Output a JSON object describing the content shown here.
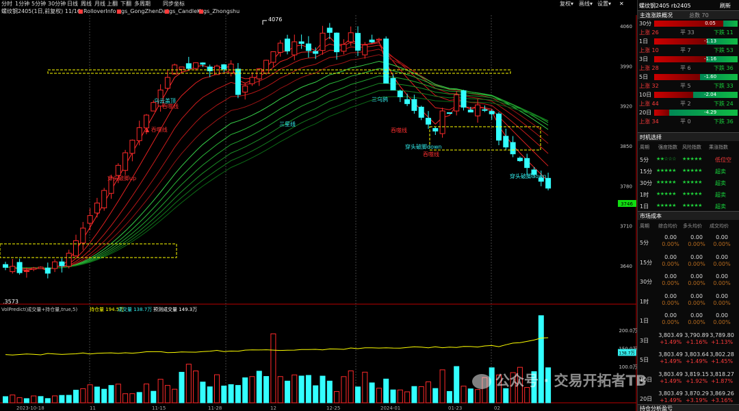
{
  "top": {
    "tabs": [
      "分时",
      "1分钟",
      "5分钟",
      "30分钟",
      "日线",
      "周线",
      "月线",
      "上翻",
      "下翻",
      "多周期",
      "同步坐标"
    ],
    "right": [
      "复权",
      "画线",
      "设置"
    ],
    "title": "螺纹钢2405 rb2405",
    "refresh": "刷新"
  },
  "legend": {
    "symbol": "螺纹钢2405(1日,前复权) 11/16",
    "items": [
      "RolloverInfo",
      "gs_GongZhenDai",
      "gs_CandleK",
      "gs_Zhongshu"
    ]
  },
  "price_axis": {
    "ticks": [
      "4060",
      "3990",
      "3920",
      "3850",
      "3780",
      "3710",
      "3640"
    ],
    "current": "3746",
    "high": "4076",
    "low": "3573"
  },
  "annotations": {
    "a1": "穿头破脚up",
    "a2": "乌云盖顶",
    "a3": "吞噬线",
    "a4": "三星线",
    "a5": "三乌鸦",
    "a6": "吞噬线",
    "a7": "穿头破脚down",
    "a8": "吞噬线",
    "a9": "穿头破脚down"
  },
  "vol": {
    "title": "VolPredict(成交量+持仓量,true,5)",
    "hold": "持仓量 194.5万",
    "trade": "成交量 138.7万",
    "predict": "预测成交量 149.3万",
    "ticks": [
      "200.0万",
      "150.0万",
      "100.0万"
    ],
    "current": "138.7万"
  },
  "dates": [
    "2023-10-18",
    "11",
    "11-15",
    "11-28",
    "12",
    "12-25",
    "2024-01",
    "01-23",
    "02"
  ],
  "side": {
    "panel1": {
      "title": "主连涨跌概况",
      "total": "总数 70",
      "rows": [
        {
          "p": "30分",
          "up": "上涨 26",
          "flat": "平 33",
          "down": "下跌 11",
          "val": "0.05"
        },
        {
          "p": "1日",
          "up": "上涨 10",
          "flat": "平 7",
          "down": "下跌 53",
          "val": "-1.13"
        },
        {
          "p": "3日",
          "up": "上涨 28",
          "flat": "平 6",
          "down": "下跌 36",
          "val": "-1.16"
        },
        {
          "p": "5日",
          "up": "上涨 32",
          "flat": "平 5",
          "down": "下跌 33",
          "val": "-1.60"
        },
        {
          "p": "10日",
          "up": "上涨 44",
          "flat": "平 2",
          "down": "下跌 24",
          "val": "-2.04"
        },
        {
          "p": "20日",
          "up": "上涨 34",
          "flat": "平 0",
          "down": "下跌 36",
          "val": "-4.29"
        }
      ]
    },
    "panel2": {
      "title": "时机选择",
      "headers": [
        "周期",
        "强度指数",
        "风险指数",
        "乘涨指数"
      ],
      "rows": [
        {
          "p": "5分",
          "a": "★★☆☆☆",
          "b": "★★★★★",
          "c": "低位空"
        },
        {
          "p": "15分",
          "a": "★★★★★",
          "b": "★★★★★",
          "c": "超卖"
        },
        {
          "p": "30分",
          "a": "★★★★★",
          "b": "★★★★★",
          "c": "超卖"
        },
        {
          "p": "1时",
          "a": "★★★★★",
          "b": "★★★★★",
          "c": "超卖"
        },
        {
          "p": "1日",
          "a": "★★★★★",
          "b": "★★★★★",
          "c": "超卖"
        }
      ]
    },
    "panel3": {
      "title": "市场成本",
      "headers": [
        "周期",
        "综合均价",
        "多头均价",
        "成交均价"
      ],
      "rows": [
        {
          "p": "5分",
          "v": [
            "0.00",
            "0.00",
            "0.00"
          ],
          "c": [
            "0.00%",
            "0.00%",
            "0.00%"
          ]
        },
        {
          "p": "15分",
          "v": [
            "0.00",
            "0.00",
            "0.00"
          ],
          "c": [
            "0.00%",
            "0.00%",
            "0.00%"
          ]
        },
        {
          "p": "30分",
          "v": [
            "0.00",
            "0.00",
            "0.00"
          ],
          "c": [
            "0.00%",
            "0.00%",
            "0.00%"
          ]
        },
        {
          "p": "1时",
          "v": [
            "0.00",
            "0.00",
            "0.00"
          ],
          "c": [
            "0.00%",
            "0.00%",
            "0.00%"
          ]
        },
        {
          "p": "1日",
          "v": [
            "0.00",
            "0.00",
            "0.00"
          ],
          "c": [
            "0.00%",
            "0.00%",
            "0.00%"
          ]
        },
        {
          "p": "3日",
          "v": [
            "3,803.49",
            "3,790.89",
            "3,789.80"
          ],
          "c": [
            "+1.49%",
            "+1.16%",
            "+1.13%"
          ]
        },
        {
          "p": "5日",
          "v": [
            "3,803.49",
            "3,803.64",
            "3,802.28"
          ],
          "c": [
            "+1.49%",
            "+1.49%",
            "+1.45%"
          ]
        },
        {
          "p": "10日",
          "v": [
            "3,803.49",
            "3,819.15",
            "3,818.27"
          ],
          "c": [
            "+1.49%",
            "+1.92%",
            "+1.87%"
          ]
        },
        {
          "p": "20日",
          "v": [
            "3,803.49",
            "3,870.29",
            "3,869.26"
          ],
          "c": [
            "+1.49%",
            "+3.19%",
            "+3.16%"
          ]
        }
      ]
    },
    "footer": "持仓分析盈亏"
  },
  "watermark": "公众号 · 交易开拓者TB"
}
